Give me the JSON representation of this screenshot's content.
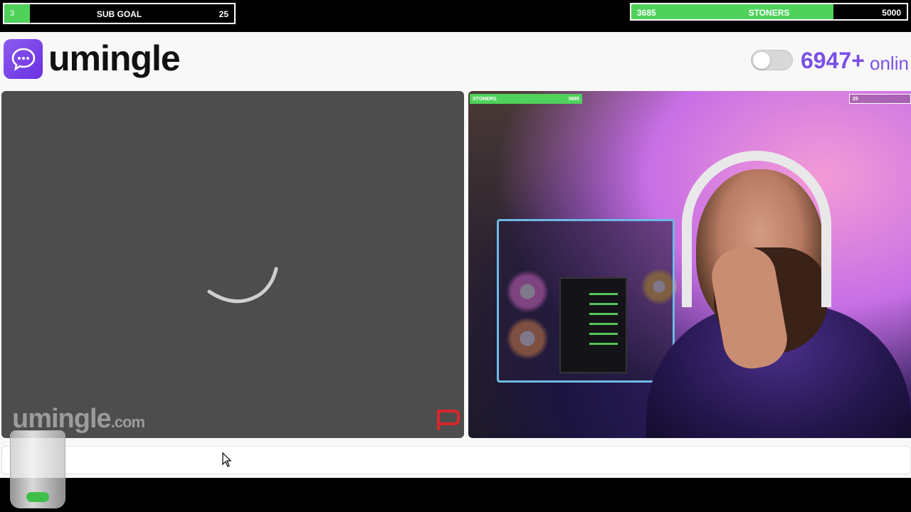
{
  "overlay": {
    "sub_goal": {
      "current": "3",
      "label": "SUB GOAL",
      "target": "25",
      "progress": 0.12
    },
    "stoners": {
      "current": "3685",
      "label": "STONERS",
      "target": "5000",
      "progress": 0.737
    }
  },
  "header": {
    "brand": "umingle",
    "online_count": "6947+",
    "online_label": "onlin"
  },
  "video_left": {
    "watermark_main": "umingle",
    "watermark_suffix": ".com"
  },
  "video_right": {
    "cam_bar_left_label": "STONERS",
    "cam_bar_left_value": "3685",
    "cam_bar_right_value": "25"
  },
  "chat": {
    "input_value": "",
    "input_placeholder": ""
  },
  "colors": {
    "accent": "#7b4fe6",
    "goal_fill": "#4fd15b",
    "video_bg": "#4d4d4d",
    "report": "#d8262b"
  },
  "icons": {
    "logo": "chat-bubble-icon",
    "loading": "spinner-icon",
    "report": "flag-icon",
    "pointer": "mouse-cursor-icon"
  }
}
